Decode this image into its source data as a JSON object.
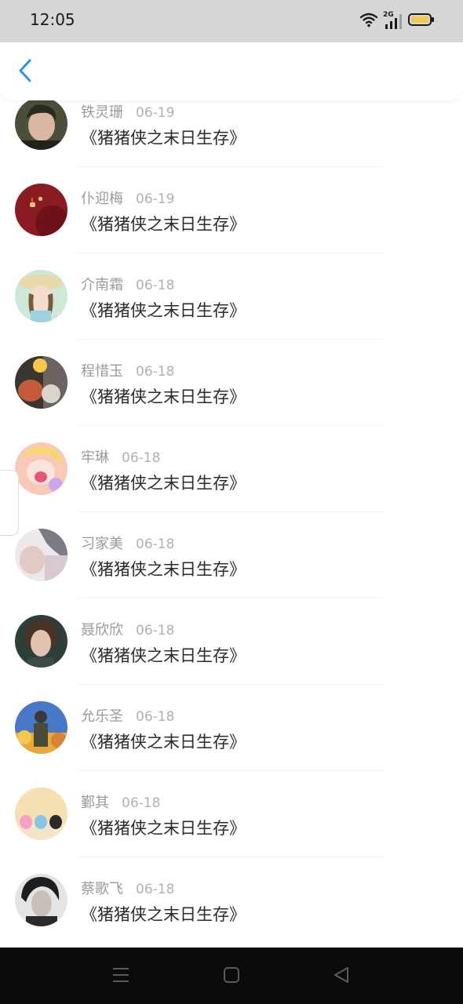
{
  "status_bar": {
    "time": "12:05",
    "network": "2G"
  },
  "header": {
    "back_icon": "chevron-left-icon",
    "accent_color": "#2196f3"
  },
  "items": [
    {
      "name": "铁灵珊",
      "date": "06-19",
      "title": "《猪猪侠之末日生存》"
    },
    {
      "name": "仆迎梅",
      "date": "06-19",
      "title": "《猪猪侠之末日生存》"
    },
    {
      "name": "介南霜",
      "date": "06-18",
      "title": "《猪猪侠之末日生存》"
    },
    {
      "name": "程惜玉",
      "date": "06-18",
      "title": "《猪猪侠之末日生存》"
    },
    {
      "name": "牢琳",
      "date": "06-18",
      "title": "《猪猪侠之末日生存》"
    },
    {
      "name": "习家美",
      "date": "06-18",
      "title": "《猪猪侠之末日生存》"
    },
    {
      "name": "聂欣欣",
      "date": "06-18",
      "title": "《猪猪侠之末日生存》"
    },
    {
      "name": "允乐圣",
      "date": "06-18",
      "title": "《猪猪侠之末日生存》"
    },
    {
      "name": "鄞其",
      "date": "06-18",
      "title": "《猪猪侠之末日生存》"
    },
    {
      "name": "蔡歌飞",
      "date": "06-18",
      "title": "《猪猪侠之末日生存》"
    }
  ],
  "nav_bar": {
    "menu_icon": "menu-icon",
    "home_icon": "home-square-icon",
    "back_icon": "back-triangle-icon"
  }
}
